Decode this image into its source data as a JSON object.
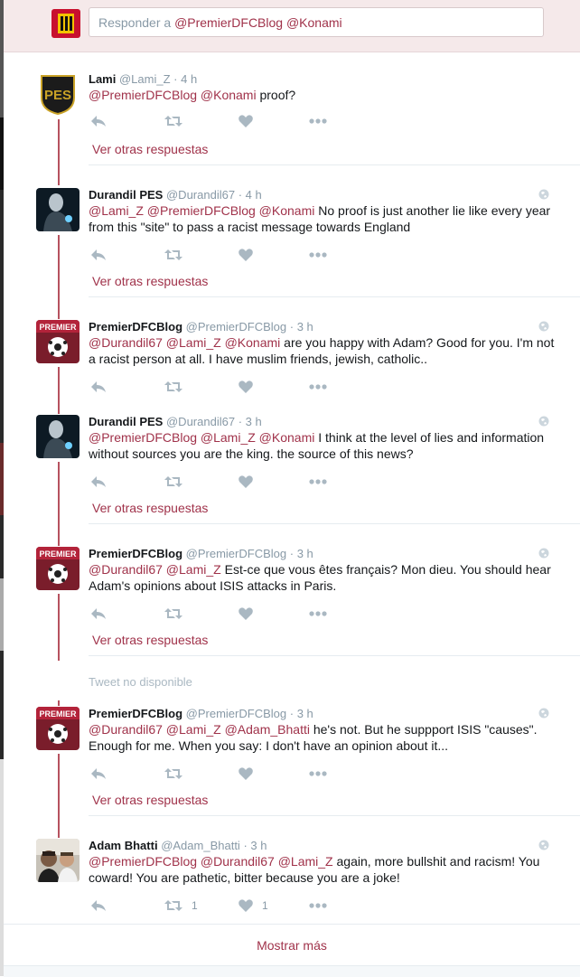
{
  "reply": {
    "prefix": "Responder a",
    "mentions": "@PremierDFCBlog @Konami"
  },
  "tweets": [
    {
      "name": "Lami",
      "handle": "@Lami_Z",
      "time": "4 h",
      "mentions": "@PremierDFCBlog @Konami",
      "text": "proof?",
      "retweets": "",
      "likes": "",
      "more_link": "Ver otras respuestas",
      "avatar": "pes-shield-logo"
    },
    {
      "name": "Durandil PES",
      "handle": "@Durandil67",
      "time": "4 h",
      "mentions": "@Lami_Z @PremierDFCBlog @Konami",
      "text": "No proof is just another lie like every year from this \"site\" to pass a racist message towards England",
      "retweets": "",
      "likes": "",
      "more_link": "Ver otras respuestas",
      "avatar": "dark-figure"
    },
    {
      "name": "PremierDFCBlog",
      "handle": "@PremierDFCBlog",
      "time": "3 h",
      "mentions": "@Durandil67 @Lami_Z @Konami",
      "text": "are you happy with Adam? Good for you. I'm not a racist person at all. I have muslim friends, jewish, catholic..",
      "retweets": "",
      "likes": "",
      "more_link": "",
      "avatar": "premier-logo"
    },
    {
      "name": "Durandil PES",
      "handle": "@Durandil67",
      "time": "3 h",
      "mentions": "@PremierDFCBlog @Lami_Z @Konami",
      "text": "I think at the level of lies and information without sources you are the king. the source of this news?",
      "retweets": "",
      "likes": "",
      "more_link": "Ver otras respuestas",
      "avatar": "dark-figure"
    },
    {
      "name": "PremierDFCBlog",
      "handle": "@PremierDFCBlog",
      "time": "3 h",
      "mentions": "@Durandil67 @Lami_Z",
      "text": "Est-ce que vous êtes français? Mon dieu. You should hear Adam's opinions about ISIS attacks in Paris.",
      "retweets": "",
      "likes": "",
      "more_link": "Ver otras respuestas",
      "avatar": "premier-logo"
    },
    {
      "name": "PremierDFCBlog",
      "handle": "@PremierDFCBlog",
      "time": "3 h",
      "mentions": "@Durandil67 @Lami_Z @Adam_Bhatti",
      "text": "he's not. But he suppport ISIS \"causes\". Enough for me. When you say: I don't have an opinion about it...",
      "retweets": "",
      "likes": "",
      "more_link": "Ver otras respuestas",
      "avatar": "premier-logo"
    },
    {
      "name": "Adam Bhatti",
      "handle": "@Adam_Bhatti",
      "time": "3 h",
      "mentions": "@PremierDFCBlog @Durandil67 @Lami_Z",
      "text": "again, more bullshit and racism! You coward! You are pathetic, bitter because you are a joke!",
      "retweets": "1",
      "likes": "1",
      "more_link": "",
      "avatar": "photo-two-people"
    }
  ],
  "unavailable_text": "Tweet no disponible",
  "show_more": "Mostrar más",
  "colors": {
    "accent": "#a0324a",
    "thread_line": "#b7525f",
    "muted": "#8899a6",
    "icon": "#aab8c2"
  },
  "icons": [
    "reply-icon",
    "retweet-icon",
    "like-icon",
    "more-icon",
    "globe-icon"
  ]
}
